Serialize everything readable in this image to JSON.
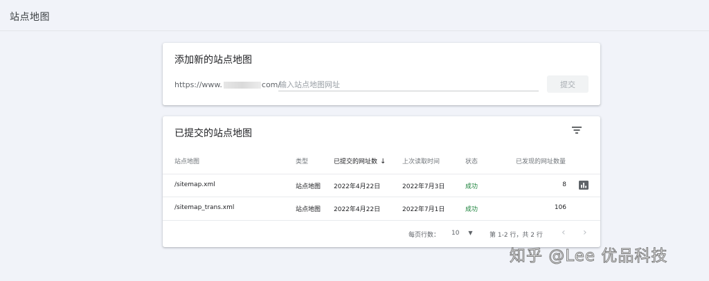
{
  "header": {
    "title": "站点地图"
  },
  "add_card": {
    "title": "添加新的站点地图",
    "url_prefix_start": "https://www.",
    "url_prefix_end": "com/",
    "input_value": "",
    "input_placeholder": "输入站点地图网址",
    "submit_label": "提交"
  },
  "submitted_card": {
    "title": "已提交的站点地图",
    "filter_icon": "filter-icon",
    "columns": [
      "站点地图",
      "类型",
      "已提交的网址数",
      "上次读取时间",
      "状态",
      "已发现的网址数量"
    ],
    "sort_indicator": "↓",
    "rows": [
      {
        "sitemap": "/sitemap.xml",
        "type": "站点地图",
        "submitted": "2022年4月22日",
        "last_read": "2022年7月3日",
        "status": "成功",
        "discovered": "8"
      },
      {
        "sitemap": "/sitemap_trans.xml",
        "type": "站点地图",
        "submitted": "2022年4月22日",
        "last_read": "2022年7月1日",
        "status": "成功",
        "discovered": "106"
      }
    ],
    "pagination": {
      "rows_per_page_label": "每页行数：",
      "rows_per_page_value": "10",
      "range_text": "第 1-2 行，共 2 行",
      "prev": "‹",
      "next": "›"
    }
  },
  "colors": {
    "success": "#188038",
    "background": "#f1f3f9",
    "card": "#ffffff"
  },
  "watermark": "知乎 @Lee 优品科技"
}
